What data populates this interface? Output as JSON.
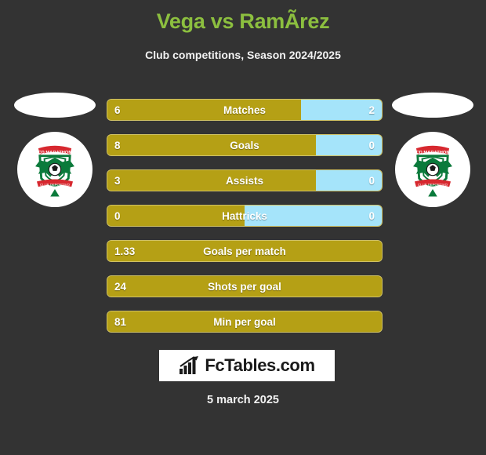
{
  "header": {
    "title": "Vega vs RamÃ­rez",
    "subtitle": "Club competitions, Season 2024/2025"
  },
  "colors": {
    "background": "#333333",
    "title_green": "#8CBF3F",
    "home_gold": "#B5A015",
    "away_blue": "#A5E4FA",
    "text_white": "#ffffff"
  },
  "home_club": {
    "crest_name": "club-crest-marathon",
    "crest_alt": "CD Marathon"
  },
  "away_club": {
    "crest_name": "club-crest-marathon",
    "crest_alt": "CD Marathon"
  },
  "stats": [
    {
      "label": "Matches",
      "home": "6",
      "away": "2",
      "home_pct": 70.6,
      "split": true
    },
    {
      "label": "Goals",
      "home": "8",
      "away": "0",
      "home_pct": 76.0,
      "split": true
    },
    {
      "label": "Assists",
      "home": "3",
      "away": "0",
      "home_pct": 76.0,
      "split": true
    },
    {
      "label": "Hattricks",
      "home": "0",
      "away": "0",
      "home_pct": 50.0,
      "split": true
    },
    {
      "label": "Goals per match",
      "home": "1.33",
      "away": "",
      "home_pct": 100,
      "split": false
    },
    {
      "label": "Shots per goal",
      "home": "24",
      "away": "",
      "home_pct": 100,
      "split": false
    },
    {
      "label": "Min per goal",
      "home": "81",
      "away": "",
      "home_pct": 100,
      "split": false
    }
  ],
  "footer": {
    "brand_icon": "bar-chart-icon",
    "brand_text": "FcTables.com",
    "date": "5 march 2025"
  }
}
